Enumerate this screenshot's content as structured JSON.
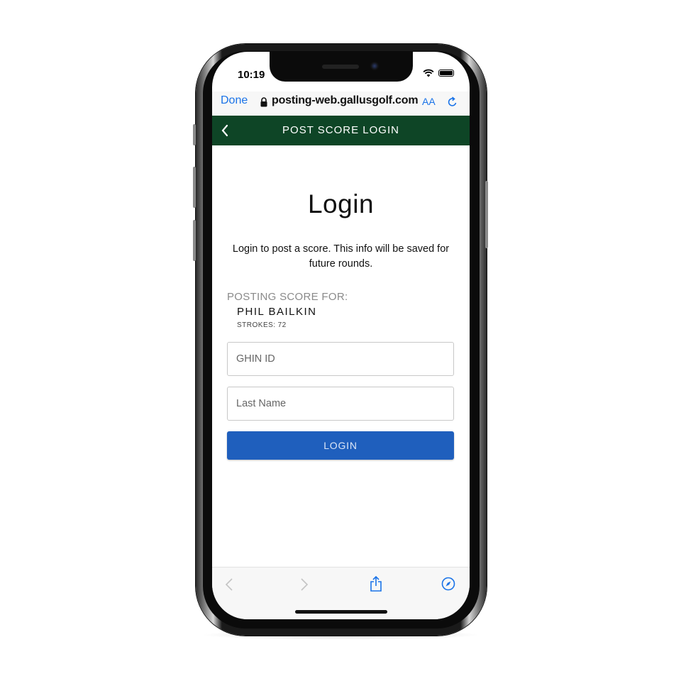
{
  "status_bar": {
    "time": "10:19"
  },
  "browser": {
    "done_label": "Done",
    "url": "posting-web.gallusgolf.com",
    "text_size_label": "AA"
  },
  "header": {
    "title": "POST SCORE LOGIN"
  },
  "main": {
    "title": "Login",
    "intro": "Login to post a score. This info will be saved for future rounds.",
    "posting_label": "POSTING SCORE FOR:",
    "golfer_name": "PHIL BAILKIN",
    "strokes_label": "STROKES:",
    "strokes_value": "72",
    "ghin_placeholder": "GHIN ID",
    "last_name_placeholder": "Last Name",
    "login_label": "LOGIN"
  },
  "colors": {
    "header_bg": "#0e4526",
    "button_bg": "#1f5fbd",
    "link_blue": "#1a73e8"
  }
}
